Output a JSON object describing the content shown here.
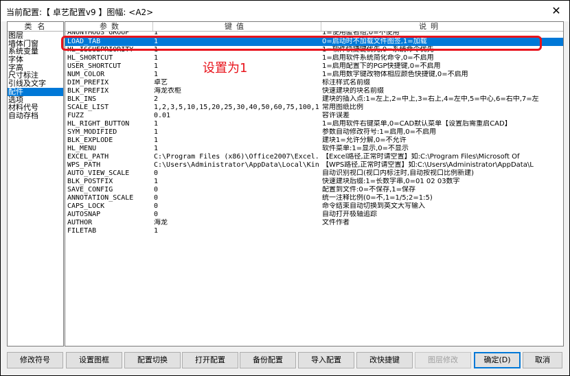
{
  "window": {
    "title": "当前配置:【 卓艺配置v9 】图幅: <A2>",
    "close_glyph": "✕"
  },
  "categories": {
    "header": "类名",
    "items": [
      {
        "label": "图层",
        "selected": false
      },
      {
        "label": "墙体门窗",
        "selected": false
      },
      {
        "label": "系统变量",
        "selected": false
      },
      {
        "label": "字体",
        "selected": false
      },
      {
        "label": "字高",
        "selected": false
      },
      {
        "label": "尺寸标注",
        "selected": false
      },
      {
        "label": "引线及文字",
        "selected": false
      },
      {
        "label": "配件",
        "selected": true
      },
      {
        "label": "选项",
        "selected": false
      },
      {
        "label": "材料代号",
        "selected": false
      },
      {
        "label": "自动存档",
        "selected": false
      }
    ]
  },
  "table": {
    "headers": {
      "param": "参数",
      "key": "键值",
      "desc": "说明"
    },
    "clipped_row": {
      "key": "ANONYMOUS_GROUP",
      "val": "1",
      "desc": "1=使用匿名组,0=不使用"
    },
    "rows": [
      {
        "key": "LOAD_TAB",
        "val": "1",
        "desc": "0=启动时不加载文件图签,1=加载",
        "selected": true
      },
      {
        "key": "HL_ISSUEPRIORITY",
        "val": "1",
        "desc": "1=软件快捷键优先,0=系统命令优先",
        "selected": false
      },
      {
        "key": "HL_SHORTCUT",
        "val": "1",
        "desc": "1=启用软件系统简化命令,0=不启用",
        "selected": false
      },
      {
        "key": "USER_SHORTCUT",
        "val": "1",
        "desc": "1=启用配置下的PGP快捷键,0=不启用",
        "selected": false
      },
      {
        "key": "NUM_COLOR",
        "val": "1",
        "desc": "1=启用数字键改物体相应颜色快捷键,0=不启用",
        "selected": false
      },
      {
        "key": "DIM_PREFIX",
        "val": "卓艺",
        "desc": "标注样式名前缀",
        "selected": false
      },
      {
        "key": "BLK_PREFIX",
        "val": "海龙衣柜",
        "desc": "快速建块的块名前缀",
        "selected": false
      },
      {
        "key": "BLK_INS",
        "val": "2",
        "desc": "建块的插入点:1=左上,2=中上,3=右上,4=左中,5=中心,6=右中,7=左",
        "selected": false
      },
      {
        "key": "SCALE_LIST",
        "val": "1,2,3,5,10,15,20,25,30,40,50,60,75,100,1",
        "desc": "常用图纸比例",
        "selected": false
      },
      {
        "key": "FUZZ",
        "val": "0.01",
        "desc": "容许误差",
        "selected": false
      },
      {
        "key": "HL_RIGHT_BUTTON",
        "val": "1",
        "desc": "1=启用软件右键菜单,0=CAD默认菜单【设置后需重启CAD】",
        "selected": false
      },
      {
        "key": "SYM_MODIFIED",
        "val": "1",
        "desc": "参数自动修改符号:1=启用,0=不启用",
        "selected": false
      },
      {
        "key": "BLK_EXPLODE",
        "val": "1",
        "desc": "建块1=允许分解,0=不允许",
        "selected": false
      },
      {
        "key": "HL_MENU",
        "val": "1",
        "desc": "软件菜单:1=显示,0=不显示",
        "selected": false
      },
      {
        "key": "EXCEL_PATH",
        "val": "C:\\Program Files (x86)\\Office2007\\Excel.",
        "desc": "【Excel路径,正常时请空置】如:C:\\Program Files\\Microsoft Of",
        "selected": false
      },
      {
        "key": "WPS_PATH",
        "val": "C:\\Users\\Administrator\\AppData\\Local\\Kin",
        "desc": "【WPS路径,正常时请空置】如:C:\\Users\\Administrator\\AppData\\L",
        "selected": false
      },
      {
        "key": "AUTO_VIEW_SCALE",
        "val": "0",
        "desc": "自动识别视口(视口内标注时,自动按视口比例新建)",
        "selected": false
      },
      {
        "key": "BLK_POSTFIX",
        "val": "1",
        "desc": "快速建块后缀:1=长数字串,0=01 02 03数字",
        "selected": false
      },
      {
        "key": "SAVE_CONFIG",
        "val": "0",
        "desc": "配置到文件:0=不保存,1=保存",
        "selected": false
      },
      {
        "key": "ANNOTATION_SCALE",
        "val": "0",
        "desc": "统一注释比例(0=不,1=1/5;2=1:5)",
        "selected": false
      },
      {
        "key": "CAPS_LOCK",
        "val": "0",
        "desc": "命令结束自动切换到英文大写输入",
        "selected": false
      },
      {
        "key": "AUTOSNAP",
        "val": "0",
        "desc": "自动打开极轴追踪",
        "selected": false
      },
      {
        "key": "AUTHOR",
        "val": "海龙",
        "desc": "文件作者",
        "selected": false
      },
      {
        "key": "FILETAB",
        "val": "1",
        "desc": "",
        "selected": false
      }
    ]
  },
  "annotation": {
    "text": "设置为1",
    "color": "#e8141c"
  },
  "buttons": {
    "modify_symbol": "修改符号",
    "set_frame": "设置图框",
    "switch_config": "配置切换",
    "open_config": "打开配置",
    "backup_config": "备份配置",
    "import_config": "导入配置",
    "change_shortcut": "改快捷键",
    "layer_modify": "图层修改",
    "ok": "确定(D)",
    "cancel": "取消"
  },
  "colors": {
    "selection": "#0078d7",
    "annotation": "#e8141c"
  }
}
